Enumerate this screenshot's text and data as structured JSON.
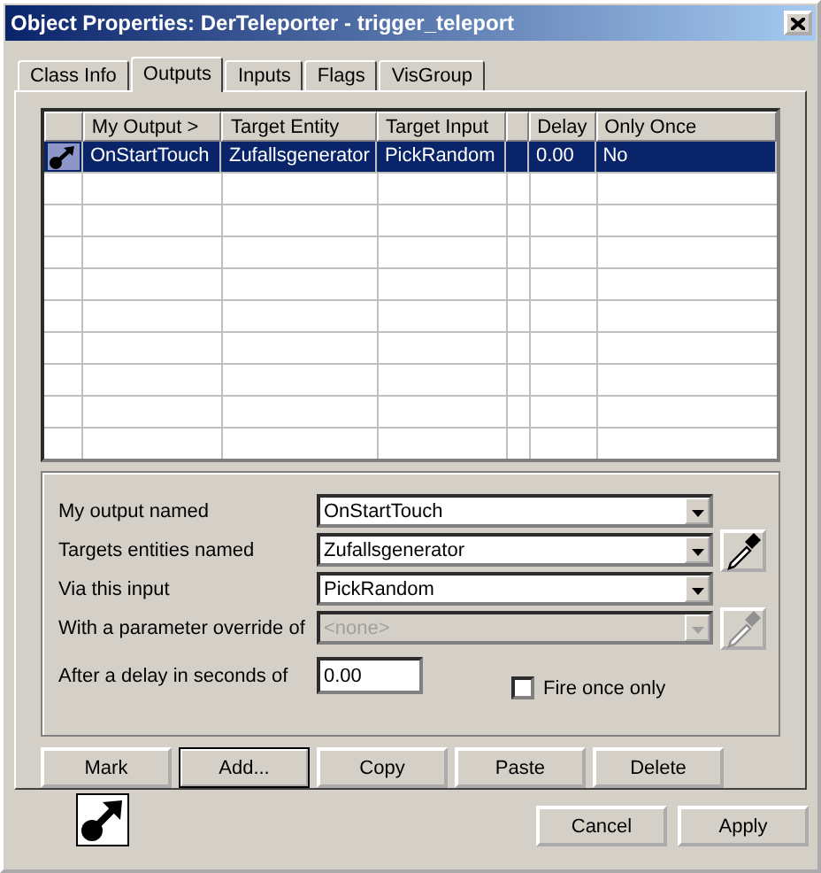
{
  "window": {
    "title": "Object Properties: DerTeleporter - trigger_teleport"
  },
  "tabs": [
    {
      "label": "Class Info",
      "selected": false
    },
    {
      "label": "Outputs",
      "selected": true
    },
    {
      "label": "Inputs",
      "selected": false
    },
    {
      "label": "Flags",
      "selected": false
    },
    {
      "label": "VisGroup",
      "selected": false
    }
  ],
  "table": {
    "columns": [
      {
        "kind": "icon"
      },
      {
        "kind": "text",
        "label": "My Output >"
      },
      {
        "kind": "text",
        "label": "Target Entity"
      },
      {
        "kind": "text",
        "label": "Target Input"
      },
      {
        "kind": "blank"
      },
      {
        "kind": "text",
        "label": "Delay"
      },
      {
        "kind": "text",
        "label": "Only Once"
      }
    ],
    "rows": [
      {
        "selected": true,
        "cells": [
          "",
          "OnStartTouch",
          "Zufallsgenerator",
          "PickRandom",
          "",
          "0.00",
          "No"
        ]
      }
    ]
  },
  "form": {
    "fields": [
      {
        "kind": "combo",
        "label": "My output named",
        "value": "OnStartTouch",
        "disabled": false,
        "picker": false
      },
      {
        "kind": "combo",
        "label": "Targets entities named",
        "value": "Zufallsgenerator",
        "disabled": false,
        "picker": true
      },
      {
        "kind": "combo",
        "label": "Via this input",
        "value": "PickRandom",
        "disabled": false,
        "picker": false
      },
      {
        "kind": "combo",
        "label": "With a parameter override of",
        "value": "<none>",
        "disabled": true,
        "picker": true
      },
      {
        "kind": "text",
        "label": "After a delay in seconds of",
        "value": "0.00"
      }
    ],
    "checkbox": {
      "label": "Fire once only",
      "checked": false
    }
  },
  "buttons": [
    {
      "label": "Mark",
      "default": false
    },
    {
      "label": "Add...",
      "default": true
    },
    {
      "label": "Copy",
      "default": false
    },
    {
      "label": "Paste",
      "default": false
    },
    {
      "label": "Delete",
      "default": false
    }
  ],
  "dialog_buttons": [
    {
      "label": "Cancel"
    },
    {
      "label": "Apply"
    }
  ]
}
